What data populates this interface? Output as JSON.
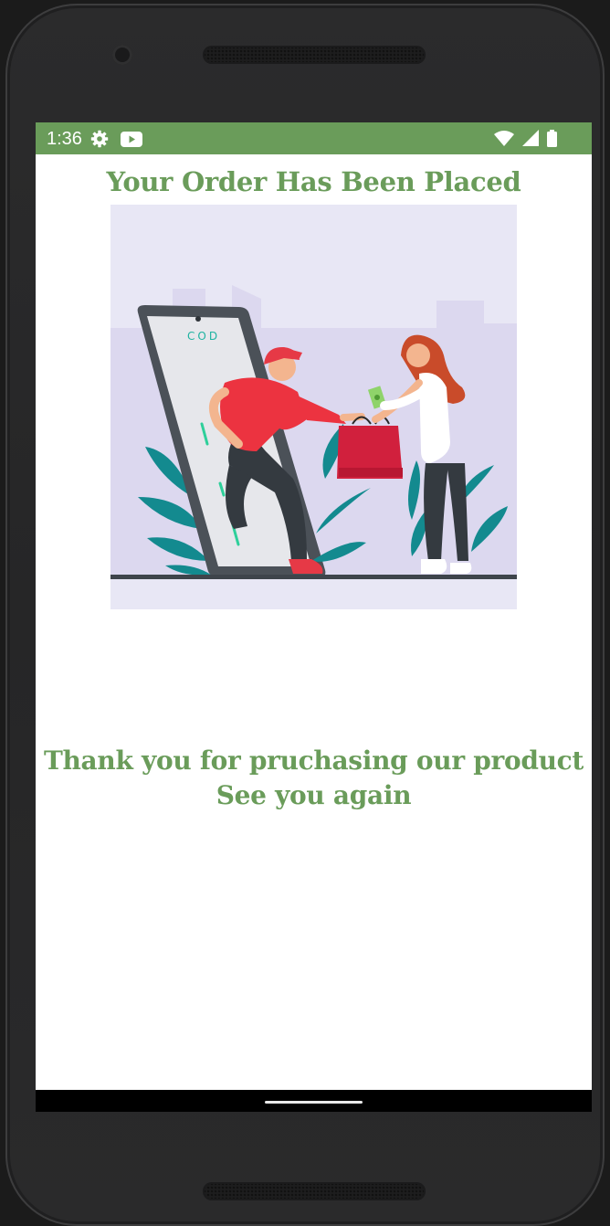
{
  "status_bar": {
    "time": "1:36",
    "icons": [
      "gear-icon",
      "youtube-icon",
      "wifi-icon",
      "signal-icon",
      "battery-icon"
    ],
    "color": "#6a9c5a"
  },
  "main": {
    "title": "Your Order Has Been Placed",
    "illustration_label": "COD",
    "thanks_line1": "Thank you for pruchasing our product",
    "thanks_line2": "See you again",
    "accent_color": "#6a9c5a"
  }
}
